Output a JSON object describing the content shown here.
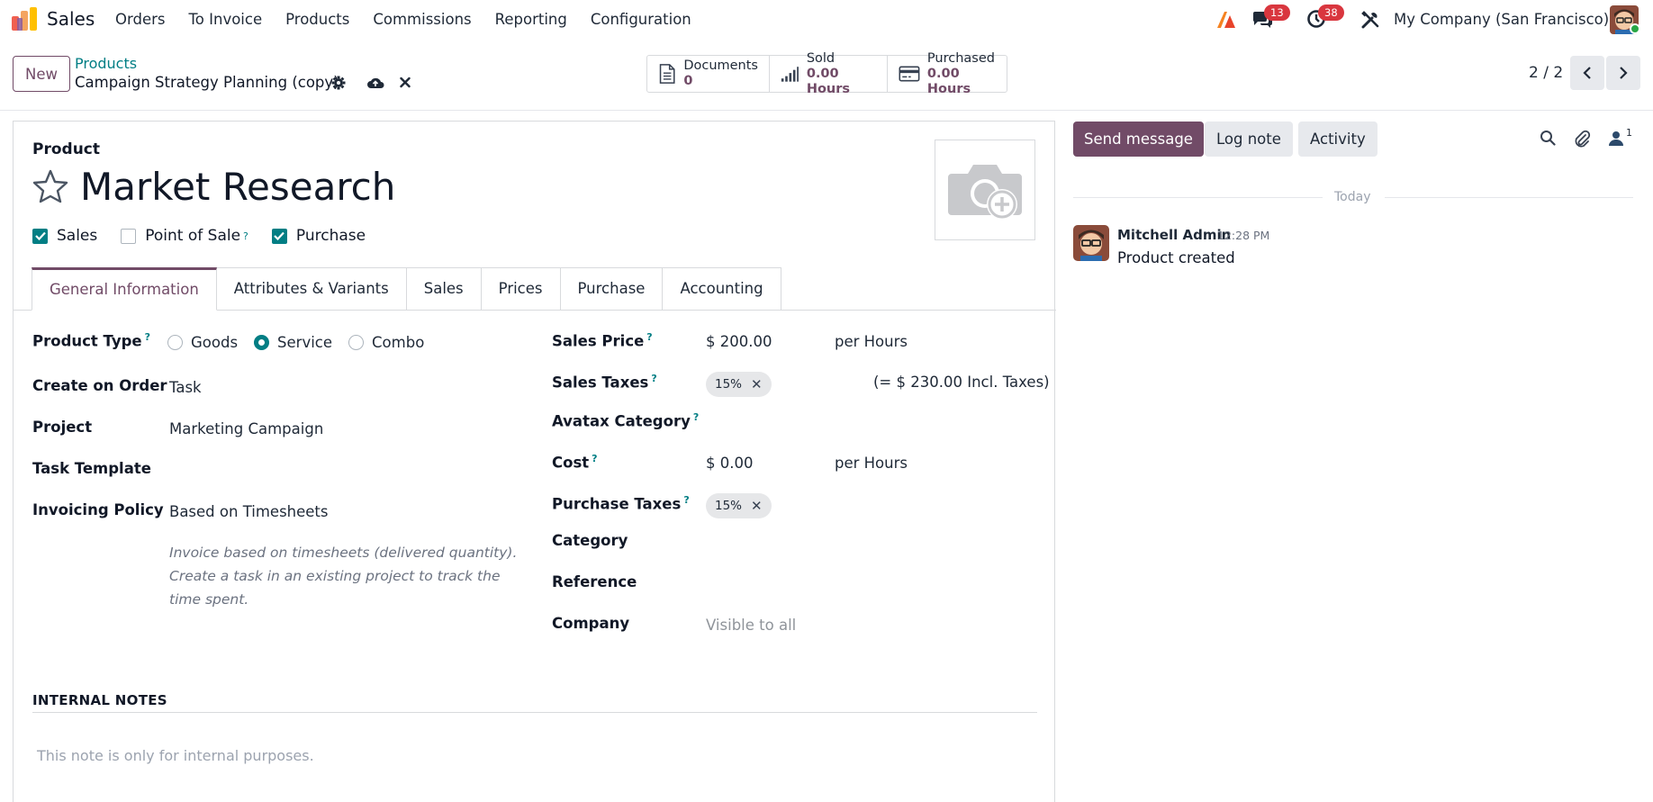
{
  "navbar": {
    "app_name": "Sales",
    "menu": [
      "Orders",
      "To Invoice",
      "Products",
      "Commissions",
      "Reporting",
      "Configuration"
    ],
    "messages_badge": "13",
    "activities_badge": "38",
    "company": "My Company (San Francisco)"
  },
  "control_panel": {
    "new_label": "New",
    "breadcrumb_parent": "Products",
    "breadcrumb_current": "Campaign Strategy Planning (copy)",
    "smart_buttons": [
      {
        "label": "Documents",
        "value": "0",
        "icon": "document-icon"
      },
      {
        "label": "Sold",
        "value": "0.00 Hours",
        "icon": "signal-bars-icon"
      },
      {
        "label": "Purchased",
        "value": "0.00 Hours",
        "icon": "credit-card-icon"
      }
    ],
    "pager": "2 / 2"
  },
  "form": {
    "product_label": "Product",
    "product_name": "Market Research",
    "checkboxes": [
      {
        "label": "Sales",
        "checked": true
      },
      {
        "label": "Point of Sale",
        "checked": false,
        "help": "?"
      },
      {
        "label": "Purchase",
        "checked": true
      }
    ],
    "tabs": [
      "General Information",
      "Attributes & Variants",
      "Sales",
      "Prices",
      "Purchase",
      "Accounting"
    ],
    "active_tab": "General Information",
    "left": {
      "product_type_label": "Product Type",
      "product_type_options": [
        "Goods",
        "Service",
        "Combo"
      ],
      "product_type_selected": "Service",
      "create_on_order_label": "Create on Order",
      "create_on_order_value": "Task",
      "project_label": "Project",
      "project_value": "Marketing Campaign",
      "task_template_label": "Task Template",
      "invoicing_policy_label": "Invoicing Policy",
      "invoicing_policy_value": "Based on Timesheets",
      "invoicing_help_1": "Invoice based on timesheets (delivered quantity).",
      "invoicing_help_2": "Create a task in an existing project to track the",
      "invoicing_help_3": "time spent."
    },
    "right": {
      "sales_price_label": "Sales Price",
      "sales_price_value": "$ 200.00",
      "sales_price_uom": "per Hours",
      "sales_taxes_label": "Sales Taxes",
      "sales_taxes_tag": "15%",
      "sales_taxes_incl": "(= $ 230.00 Incl. Taxes)",
      "avatax_label": "Avatax Category",
      "cost_label": "Cost",
      "cost_value": "$ 0.00",
      "cost_uom": "per Hours",
      "purchase_taxes_label": "Purchase Taxes",
      "purchase_taxes_tag": "15%",
      "category_label": "Category",
      "reference_label": "Reference",
      "company_label": "Company",
      "company_placeholder": "Visible to all"
    },
    "help_mark": "?",
    "internal_notes_title": "INTERNAL NOTES",
    "internal_notes_placeholder": "This note is only for internal purposes."
  },
  "chatter": {
    "send_message": "Send message",
    "log_note": "Log note",
    "activity": "Activity",
    "followers_count": "1",
    "date_separator": "Today",
    "messages": [
      {
        "author": "Mitchell Admin",
        "time": "12:28 PM",
        "body": "Product created"
      }
    ]
  },
  "colors": {
    "brand": "#714b67",
    "teal": "#017e84",
    "badge": "#d9363e"
  }
}
